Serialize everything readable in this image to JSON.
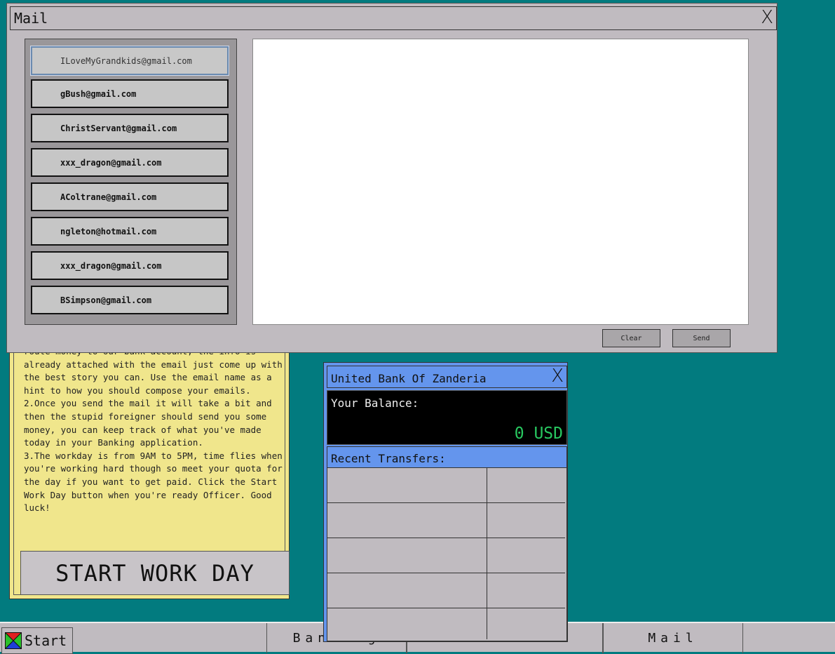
{
  "notes": {
    "text": "route money to our bank account, the info is already attached with the email just come up with the best story you can. Use the email name as a hint to how you should compose your emails.\n2.Once you send the mail it will take a bit and then the stupid foreigner should send you some money, you can keep track of what you've made today in your Banking application.\n3.The workday is from 9AM to 5PM, time flies when you're working hard though so meet your quota for the day if you want to get paid. Click the Start Work Day button when you're ready Officer. Good luck!",
    "start_button": "START WORK DAY"
  },
  "mail": {
    "title": "Mail",
    "close": "X",
    "contacts": [
      "ILoveMyGrandkids@gmail.com",
      "gBush@gmail.com",
      "ChristServant@gmail.com",
      "xxx_dragon@gmail.com",
      "AColtrane@gmail.com",
      "ngleton@hotmail.com",
      "xxx_dragon@gmail.com",
      "BSimpson@gmail.com"
    ],
    "selected_contact_index": 0,
    "compose_text": "",
    "clear_label": "Clear",
    "send_label": "Send"
  },
  "bank": {
    "title": "United Bank Of Zanderia",
    "close": "X",
    "balance_label": "Your Balance:",
    "balance_value": "0 USD",
    "transfers_label": "Recent Transfers:",
    "transfers": [
      {
        "from": "",
        "amount": ""
      },
      {
        "from": "",
        "amount": ""
      },
      {
        "from": "",
        "amount": ""
      },
      {
        "from": "",
        "amount": ""
      },
      {
        "from": "",
        "amount": ""
      }
    ]
  },
  "taskbar": {
    "start_label": "Start",
    "tasks": [
      "Banking",
      "Mail"
    ]
  },
  "colors": {
    "desktop": "#027b7f",
    "window": "#c0bbc0",
    "bank_accent": "#6495ed",
    "notes": "#f0e68c",
    "balance_text": "#28c860"
  }
}
